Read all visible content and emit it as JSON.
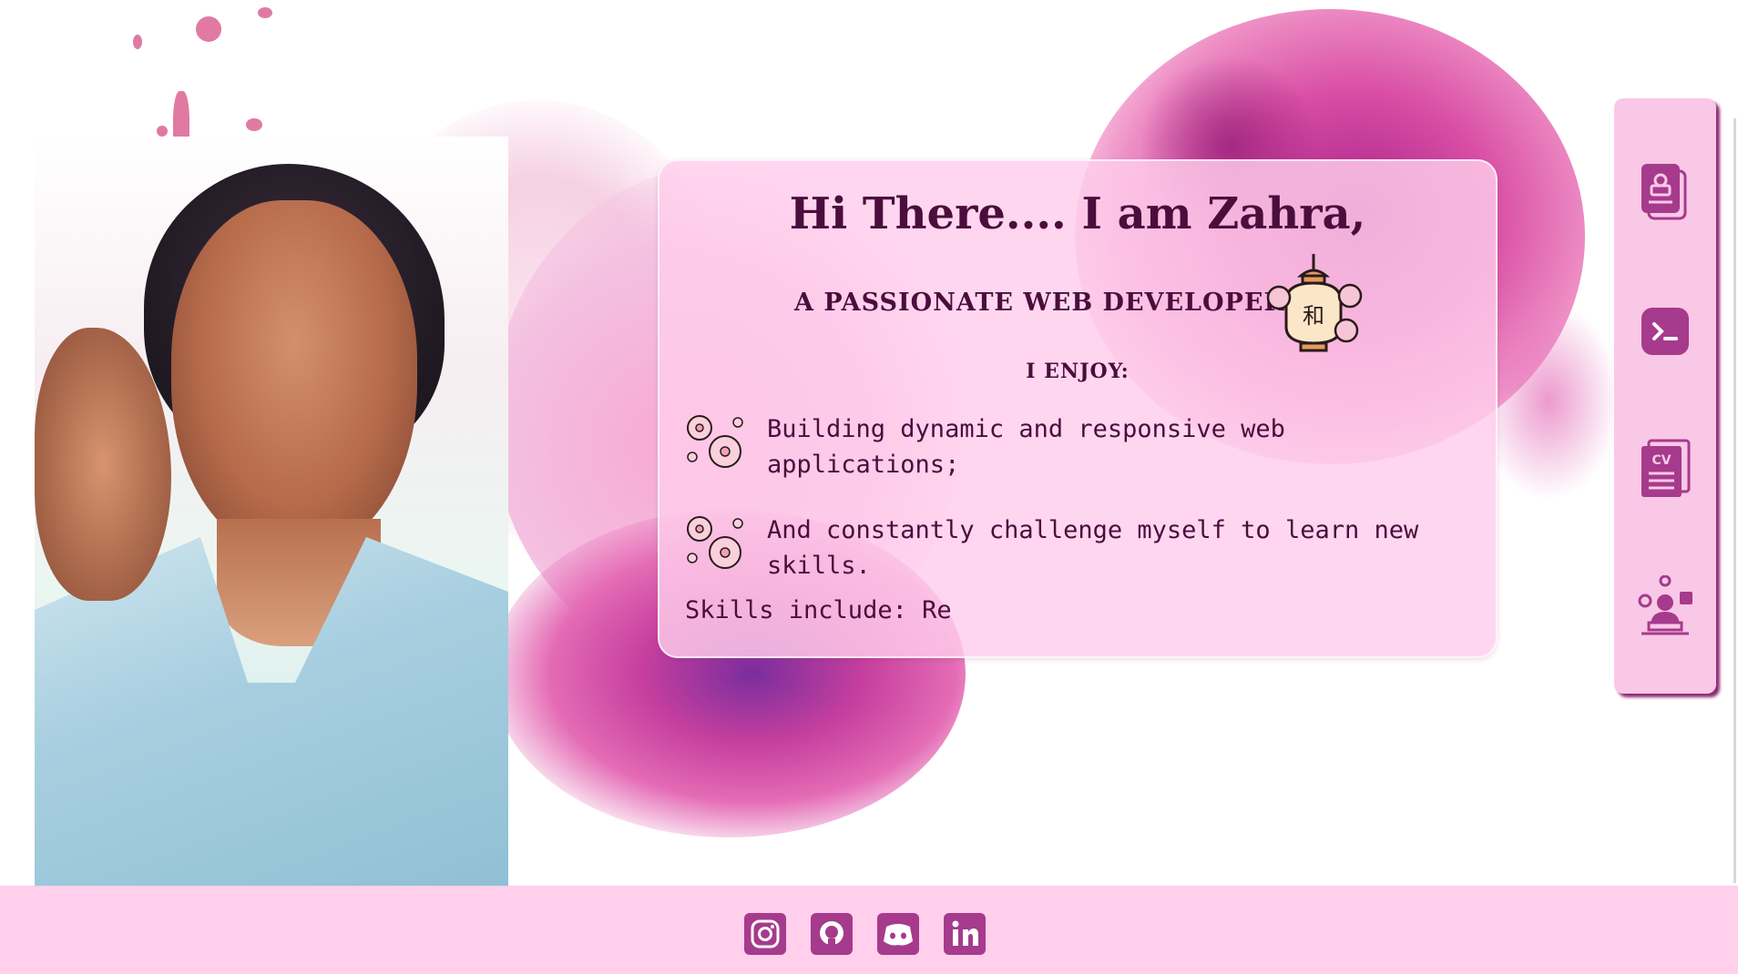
{
  "intro": {
    "greeting": "Hi There.... I am Zahra,",
    "tagline": "A PASSIONATE WEB DEVELOPER",
    "enjoy_heading": "I ENJOY:",
    "items": [
      "Building dynamic and responsive web applications;",
      "And constantly challenge myself to learn new skills."
    ],
    "skills_text": "Skills include: Re"
  },
  "nav": {
    "items": [
      "resume-icon",
      "terminal-icon",
      "cv-icon",
      "developer-icon"
    ]
  },
  "footer": {
    "social": [
      "instagram-icon",
      "github-icon",
      "discord-icon",
      "linkedin-icon"
    ]
  },
  "colors": {
    "accent": "#a63a8c",
    "text": "#4a0d3c",
    "card_bg": "#ffcdeb",
    "footer_bg": "#ffcfec",
    "nav_bg": "#f9c8e6"
  }
}
